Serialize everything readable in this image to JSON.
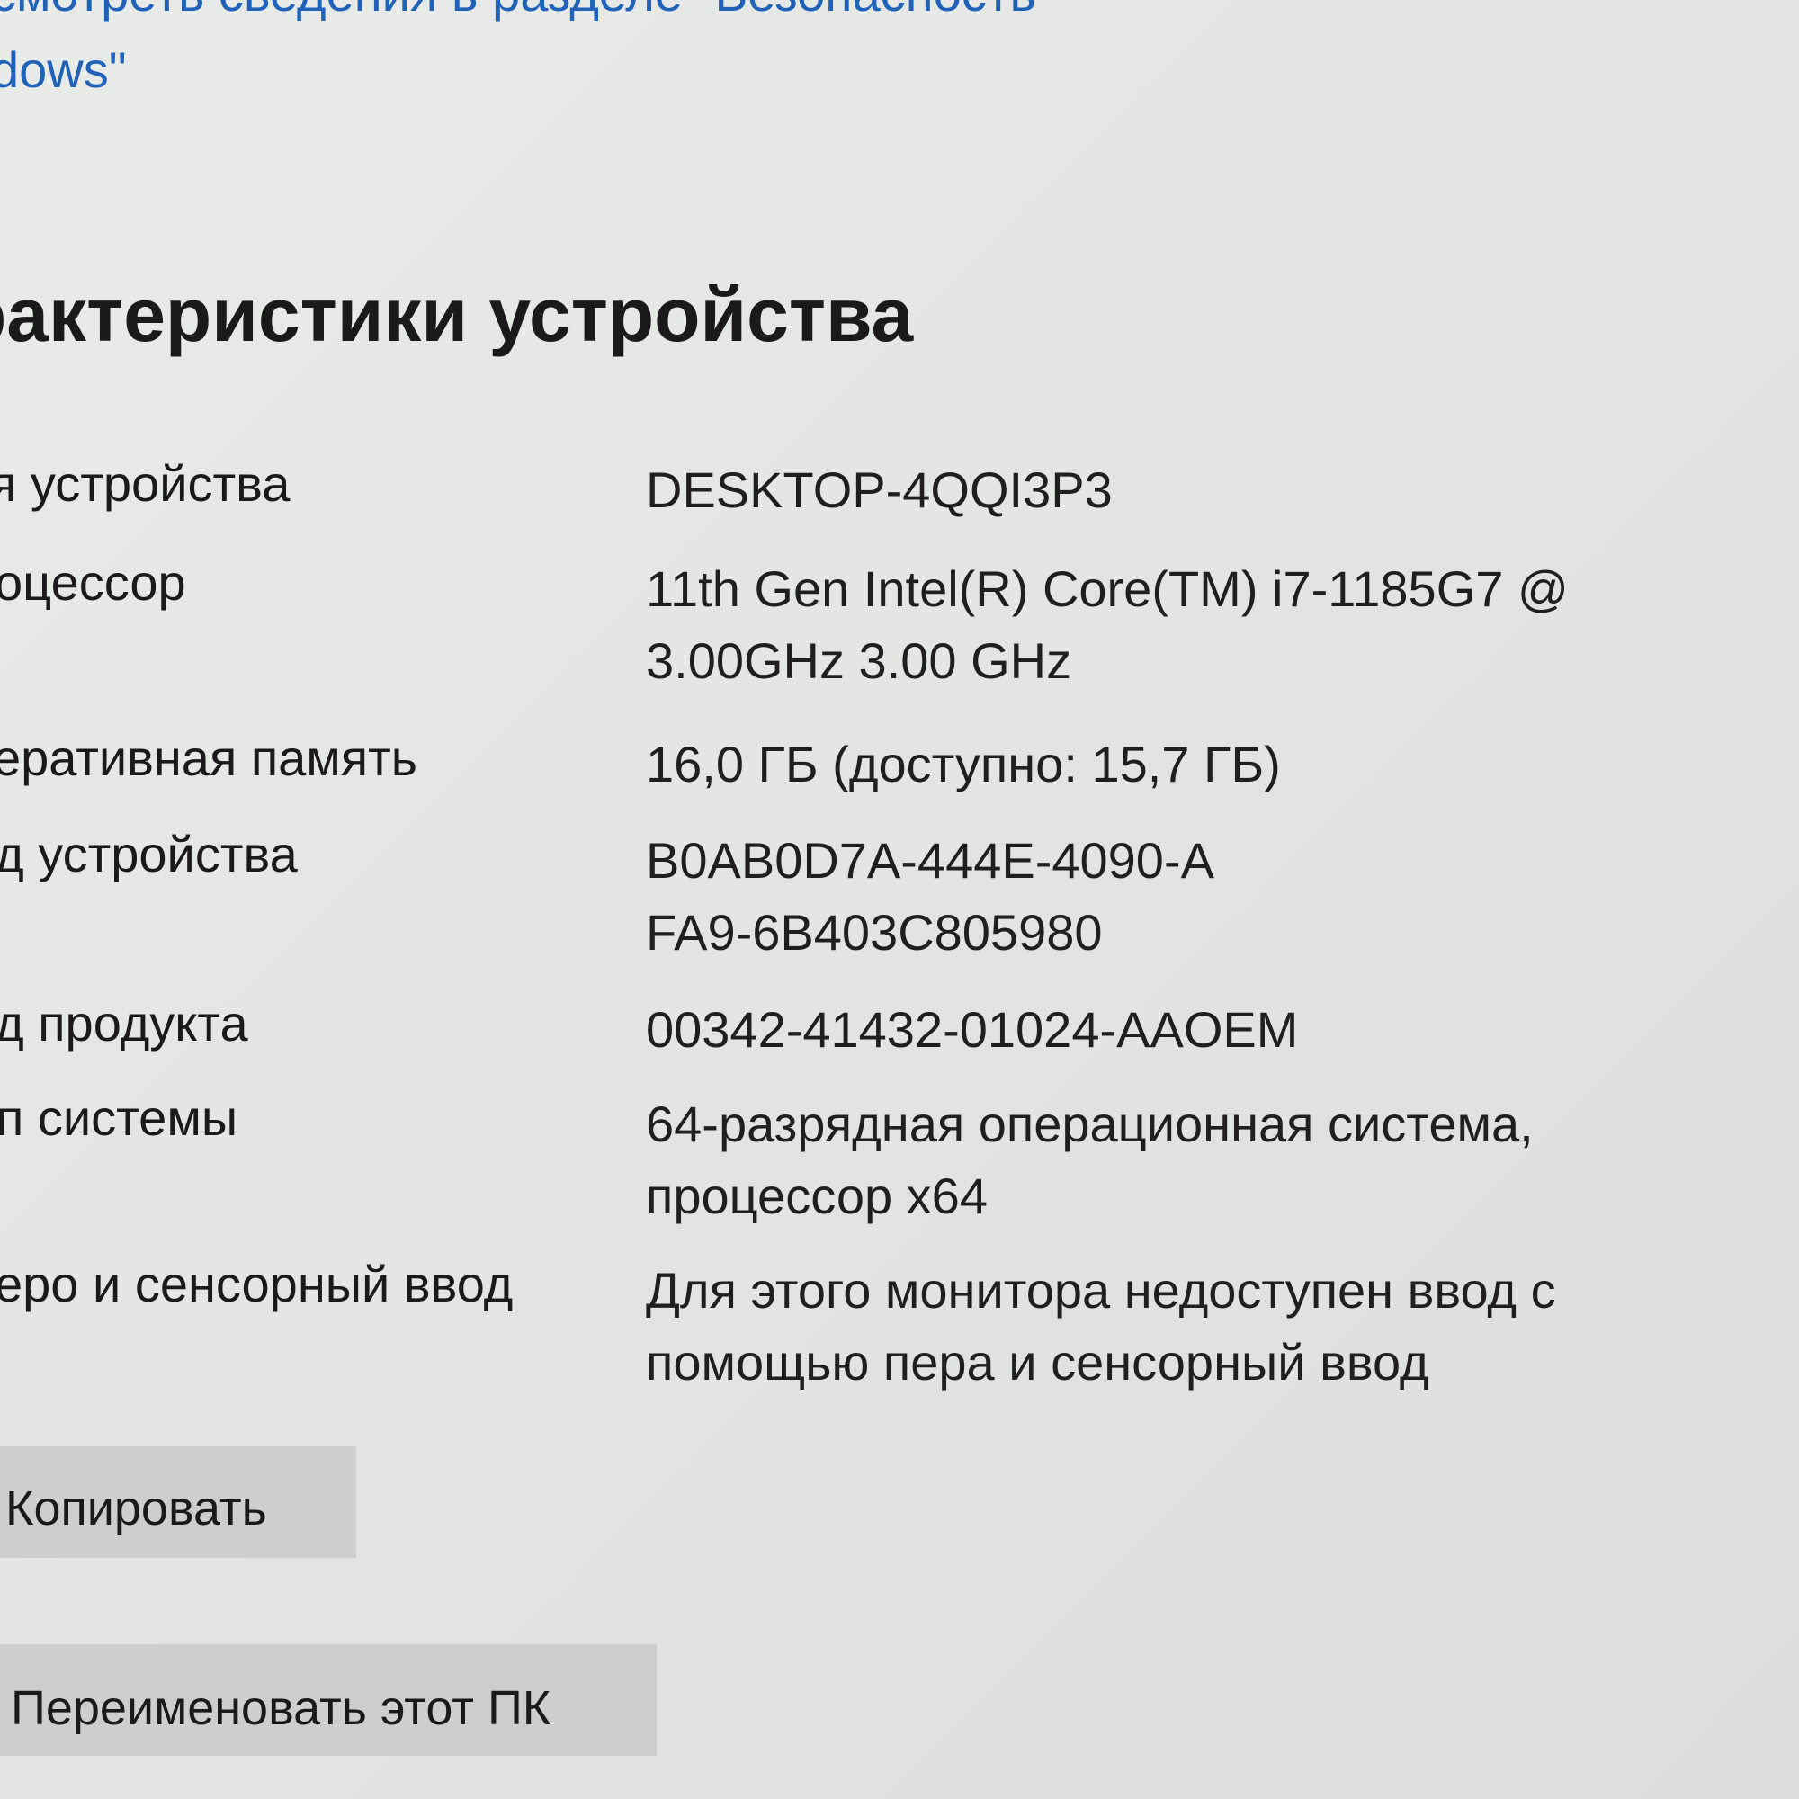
{
  "header": {
    "security_link_line1": "смотреть сведения в разделе \"Безопасность",
    "security_link_line2": "dows\""
  },
  "section": {
    "title": "рактеристики устройства"
  },
  "specs": [
    {
      "label": "я устройства",
      "value": "DESKTOP-4QQI3P3"
    },
    {
      "label": "оцессор",
      "value": "11th Gen Intel(R) Core(TM) i7-1185G7 @ 3.00GHz   3.00 GHz"
    },
    {
      "label": "еративная память",
      "value": "16,0 ГБ (доступно: 15,7 ГБ)"
    },
    {
      "label": "д устройства",
      "value": "B0AB0D7A-444E-4090-AFA9-6B403C805980"
    },
    {
      "label": "д продукта",
      "value": "00342-41432-01024-AAOEM"
    },
    {
      "label": "п системы",
      "value": "64-разрядная операционная система, процессор x64"
    },
    {
      "label": "еро и сенсорный ввод",
      "value": "Для этого монитора недоступен ввод с помощью пера и сенсорный ввод"
    }
  ],
  "buttons": {
    "copy": "Копировать",
    "rename": "Переименовать этот ПК"
  }
}
